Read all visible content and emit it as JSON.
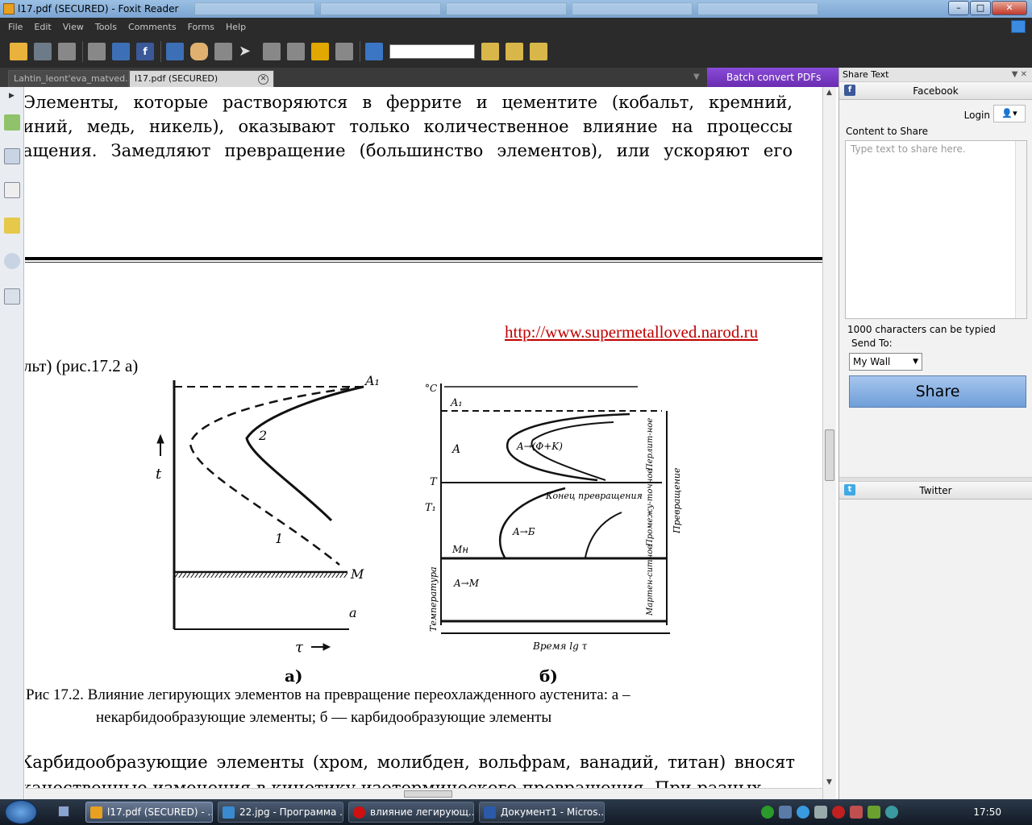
{
  "window": {
    "title": "l17.pdf (SECURED) - Foxit Reader",
    "controls": {
      "minimize": "–",
      "maximize": "□",
      "close": "✕"
    }
  },
  "menu": [
    "File",
    "Edit",
    "View",
    "Tools",
    "Comments",
    "Forms",
    "Help"
  ],
  "toolbar": {
    "icons": [
      "open-icon",
      "save-icon",
      "print-setup-icon",
      "print-icon",
      "email-icon",
      "facebook-icon",
      "screen-icon",
      "hand-icon",
      "zoom-icon",
      "select-icon",
      "text-select-icon",
      "snapshot-icon",
      "rms-lock-icon",
      "sign-icon",
      "find-icon",
      "prev-icon",
      "next-icon",
      "annotate-icon"
    ],
    "search_value": ""
  },
  "tabs": [
    {
      "label": "Lahtin_leont'eva_matved..."
    },
    {
      "label": "l17.pdf (SECURED)"
    }
  ],
  "batch_convert": "Batch convert PDFs",
  "document": {
    "para1": [
      "Элементы, которые растворяются в феррите и цементите (кобальт, кремний,",
      "иний, медь, никель), оказывают только количественное влияние на процессы",
      "ащения. Замедляют превращение (большинство элементов), или ускоряют его"
    ],
    "url": "http://www.supermetalloved.narod.ru",
    "lt_text": "льт) (рис.17.2 а)",
    "caption_line1": "Рис 17.2. Влияние легирующих элементов на превращение переохлажденного аустенита: а –",
    "caption_line2": "некарбидообразующие элементы; б — карбидообразующие элементы",
    "para2": "Карбидообразующие элементы (хром, молибден, вольфрам, ванадий, титан) вносят",
    "para2b": "качественные изменения в кинетику изотермического превращения. При разных"
  },
  "figure": {
    "left": {
      "y_axis": "t",
      "x_axis": "τ",
      "labels": {
        "a1": "A₁",
        "curve1": "1",
        "curve2": "2",
        "m": "M",
        "sub": "a"
      },
      "caption": "а)"
    },
    "right": {
      "unit": "°C",
      "labels": {
        "a1": "A₁",
        "a": "A",
        "t": "T",
        "t1": "T₁",
        "mn": "Mн",
        "pearlite_reaction": "A→(Φ+K)",
        "end_transform": "Конец превращения",
        "bainite_reaction": "A→Б",
        "martensite_reaction": "A→M",
        "x_axis": "Время lg τ",
        "y_axis": "Температура",
        "side_pearlite": "Перлит-ное",
        "side_intermediate": "Промежу-точное",
        "side_martensite": "Мартен-ситное",
        "side_transform": "Превращение"
      },
      "caption": "б)"
    }
  },
  "right_pane": {
    "header": "Share Text",
    "facebook": {
      "title": "Facebook",
      "login": "Login",
      "content_label": "Content to Share",
      "placeholder": "Type text to share here.",
      "char_limit": "1000 characters can be typied",
      "send_to": "Send To:",
      "send_to_value": "My Wall",
      "share_button": "Share"
    },
    "twitter": {
      "title": "Twitter"
    }
  },
  "taskbar": {
    "items": [
      {
        "label": "l17.pdf (SECURED) - ...",
        "color": "#e8a020"
      },
      {
        "label": "22.jpg - Программа ...",
        "color": "#3a8ad0"
      },
      {
        "label": "влияние легирующ...",
        "color": "#d01010"
      },
      {
        "label": "Документ1 - Micros...",
        "color": "#2a5aa8"
      }
    ],
    "clock": "17:50"
  },
  "colors": {
    "accent_purple": "#7a3cc4",
    "url_red": "#c00000",
    "facebook_blue": "#3b5998",
    "twitter_blue": "#3fa9e6"
  }
}
